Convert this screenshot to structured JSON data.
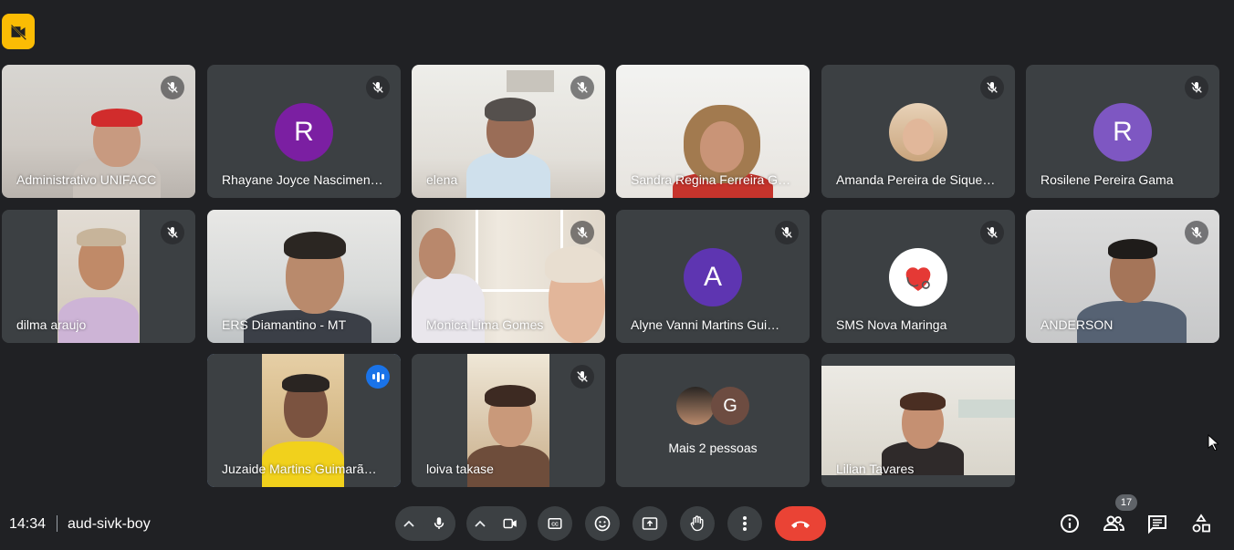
{
  "badge": {
    "icon": "no-video-camera-icon",
    "color": "#fbbc04"
  },
  "participants": [
    {
      "name": "Administrativo UNIFACC",
      "muted": true,
      "video": true
    },
    {
      "name": "Rhayane Joyce Nascimen…",
      "muted": true,
      "video": false,
      "initial": "R",
      "avatar_color": "#7b1fa2"
    },
    {
      "name": "elena",
      "muted": true,
      "video": true
    },
    {
      "name": "Sandra Regina Ferreira G…",
      "muted": false,
      "video": true
    },
    {
      "name": "Amanda Pereira de Sique…",
      "muted": true,
      "video": false,
      "photo_avatar": true
    },
    {
      "name": "Rosilene Pereira Gama",
      "muted": true,
      "video": false,
      "initial": "R",
      "avatar_color": "#7e57c2"
    },
    {
      "name": "dilma araujo",
      "muted": true,
      "video": true
    },
    {
      "name": "ERS Diamantino - MT",
      "muted": false,
      "video": true
    },
    {
      "name": "Monica Lima Gomes",
      "muted": true,
      "video": true
    },
    {
      "name": "Alyne Vanni Martins Gui…",
      "muted": true,
      "video": false,
      "initial": "A",
      "avatar_color": "#5e35b1"
    },
    {
      "name": "SMS Nova Maringa",
      "muted": true,
      "video": false,
      "photo_avatar": true
    },
    {
      "name": "ANDERSON",
      "muted": true,
      "video": true
    },
    {
      "name": "Juzaide Martins Guimarã…",
      "muted": false,
      "speaking": true,
      "video": true
    },
    {
      "name": "loiva takase",
      "muted": true,
      "video": true
    },
    {
      "name": "Lilian Tavares",
      "muted": false,
      "video": true
    }
  ],
  "more_tile": {
    "label": "Mais 2 pessoas",
    "initial": "G",
    "initial_color": "#6d4c41"
  },
  "footer": {
    "time": "14:34",
    "meeting_code": "aud-sivk-boy",
    "people_count": "17",
    "end_call_color": "#ea4335"
  },
  "controls": {
    "mic": "microphone-icon",
    "camera": "video-camera-icon",
    "captions": "closed-captions-icon",
    "reactions": "emoji-icon",
    "present": "present-screen-icon",
    "raise_hand": "raise-hand-icon",
    "more": "more-options-icon",
    "end_call": "end-call-icon",
    "info": "info-icon",
    "people": "people-icon",
    "chat": "chat-icon",
    "activities": "activities-icon"
  }
}
